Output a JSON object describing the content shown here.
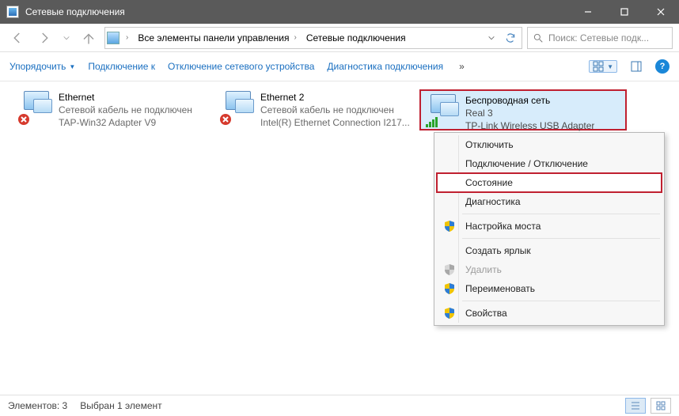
{
  "titlebar": {
    "title": "Сетевые подключения"
  },
  "breadcrumbs": {
    "item1": "Все элементы панели управления",
    "item2": "Сетевые подключения"
  },
  "search": {
    "placeholder": "Поиск: Сетевые подк..."
  },
  "toolbar": {
    "organize": "Упорядочить",
    "connect": "Подключение к",
    "disable": "Отключение сетевого устройства",
    "diagnose": "Диагностика подключения",
    "overflow": "»"
  },
  "adapters": {
    "a1": {
      "name": "Ethernet",
      "status": "Сетевой кабель не подключен",
      "device": "TAP-Win32 Adapter V9"
    },
    "a2": {
      "name": "Ethernet 2",
      "status": "Сетевой кабель не подключен",
      "device": "Intel(R) Ethernet Connection I217..."
    },
    "a3": {
      "name": "Беспроводная сеть",
      "status": "Real 3",
      "device": "TP-Link Wireless USB Adapter"
    }
  },
  "context_menu": {
    "disable": "Отключить",
    "connect": "Подключение / Отключение",
    "status": "Состояние",
    "diagnose": "Диагностика",
    "bridge": "Настройка моста",
    "shortcut": "Создать ярлык",
    "delete": "Удалить",
    "rename": "Переименовать",
    "properties": "Свойства"
  },
  "statusbar": {
    "count": "Элементов: 3",
    "selection": "Выбран 1 элемент"
  }
}
